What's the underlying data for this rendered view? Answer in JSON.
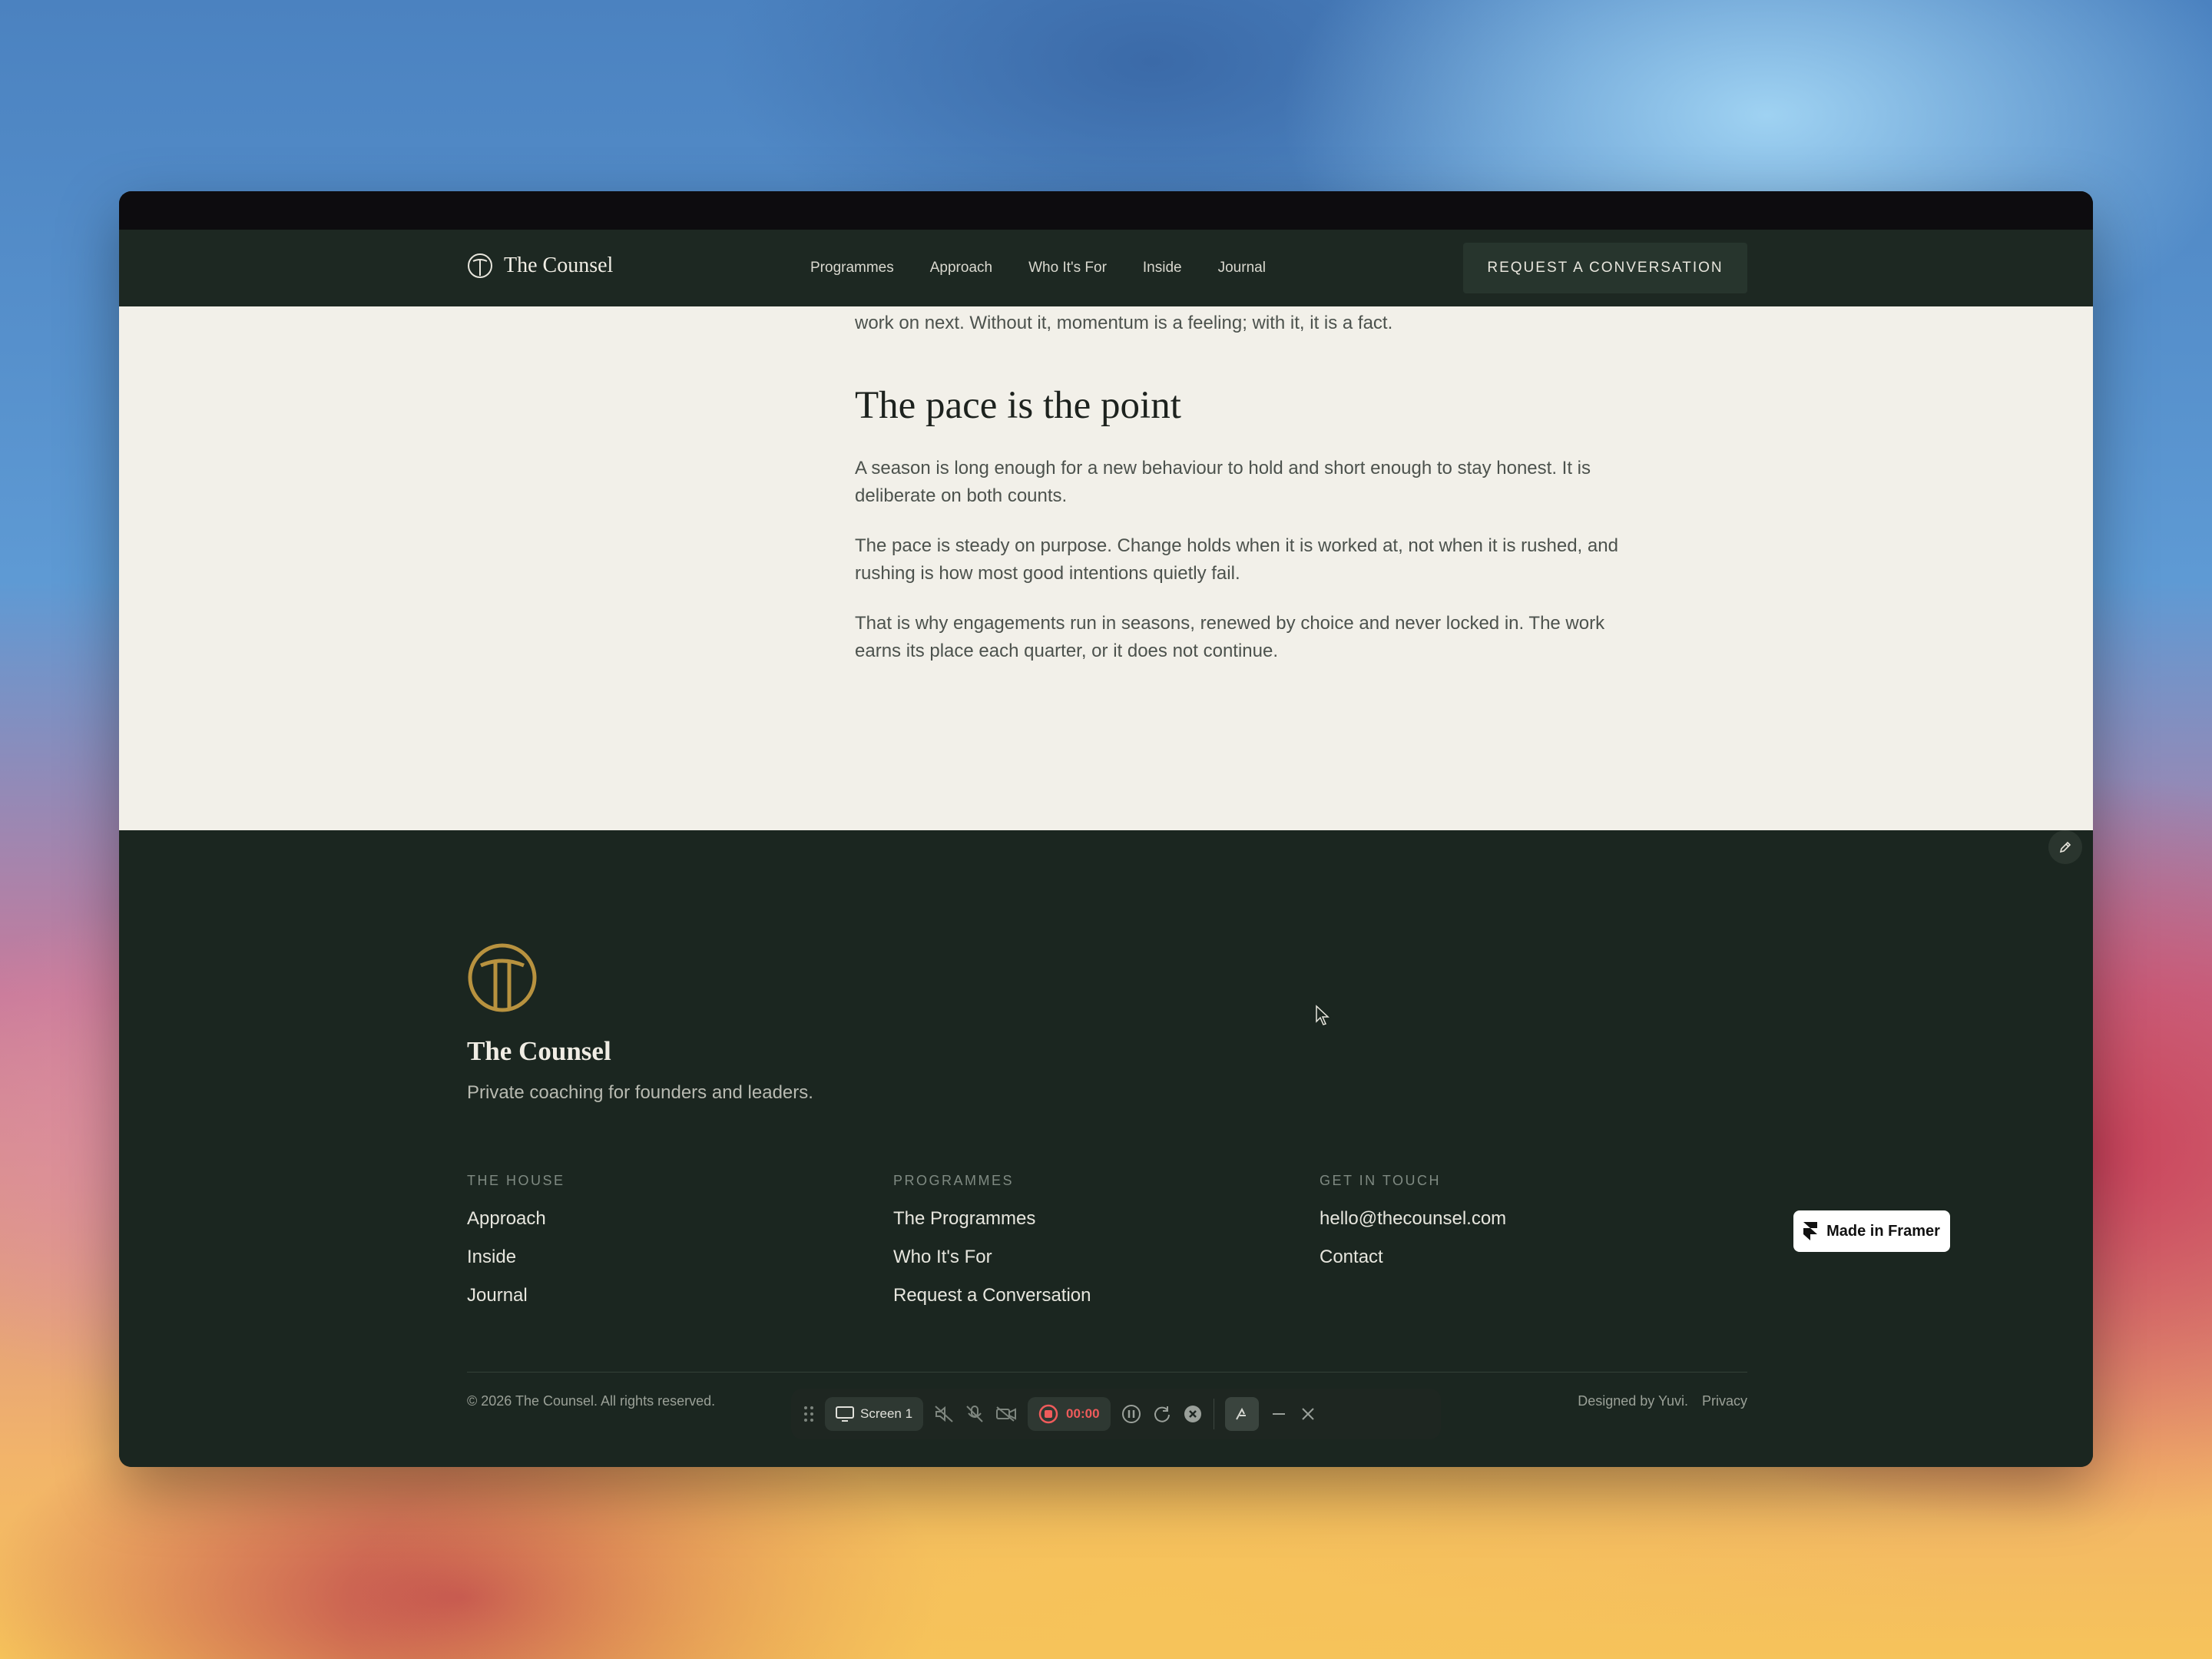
{
  "nav": {
    "brand": "The Counsel",
    "links": [
      "Programmes",
      "Approach",
      "Who It's For",
      "Inside",
      "Journal"
    ],
    "cta": "REQUEST A CONVERSATION"
  },
  "article": {
    "lead": "work on next. Without it, momentum is a feeling; with it, it is a fact.",
    "heading": "The pace is the point",
    "paragraphs": [
      "A season is long enough for a new behaviour to hold and short enough to stay honest. It is deliberate on both counts.",
      "The pace is steady on purpose. Change holds when it is worked at, not when it is rushed, and rushing is how most good intentions quietly fail.",
      "That is why engagements run in seasons, renewed by choice and never locked in. The work earns its place each quarter, or it does not continue."
    ]
  },
  "footer": {
    "name": "The Counsel",
    "tagline": "Private coaching for founders and leaders.",
    "columns": [
      {
        "heading": "THE HOUSE",
        "links": [
          "Approach",
          "Inside",
          "Journal"
        ]
      },
      {
        "heading": "PROGRAMMES",
        "links": [
          "The Programmes",
          "Who It's For",
          "Request a Conversation"
        ]
      },
      {
        "heading": "GET IN TOUCH",
        "links": [
          "hello@thecounsel.com",
          "Contact"
        ]
      }
    ],
    "copyright": "© 2026 The Counsel. All rights reserved.",
    "designed_by": "Designed by Yuvi.",
    "privacy": "Privacy"
  },
  "recorder": {
    "screen_label": "Screen 1",
    "timer": "00:00"
  },
  "framer_badge": "Made in Framer",
  "colors": {
    "accent_gold": "#b8923f",
    "dark_green": "#1b2620",
    "cream": "#f2f0e9",
    "record_red": "#ef5b5b"
  }
}
